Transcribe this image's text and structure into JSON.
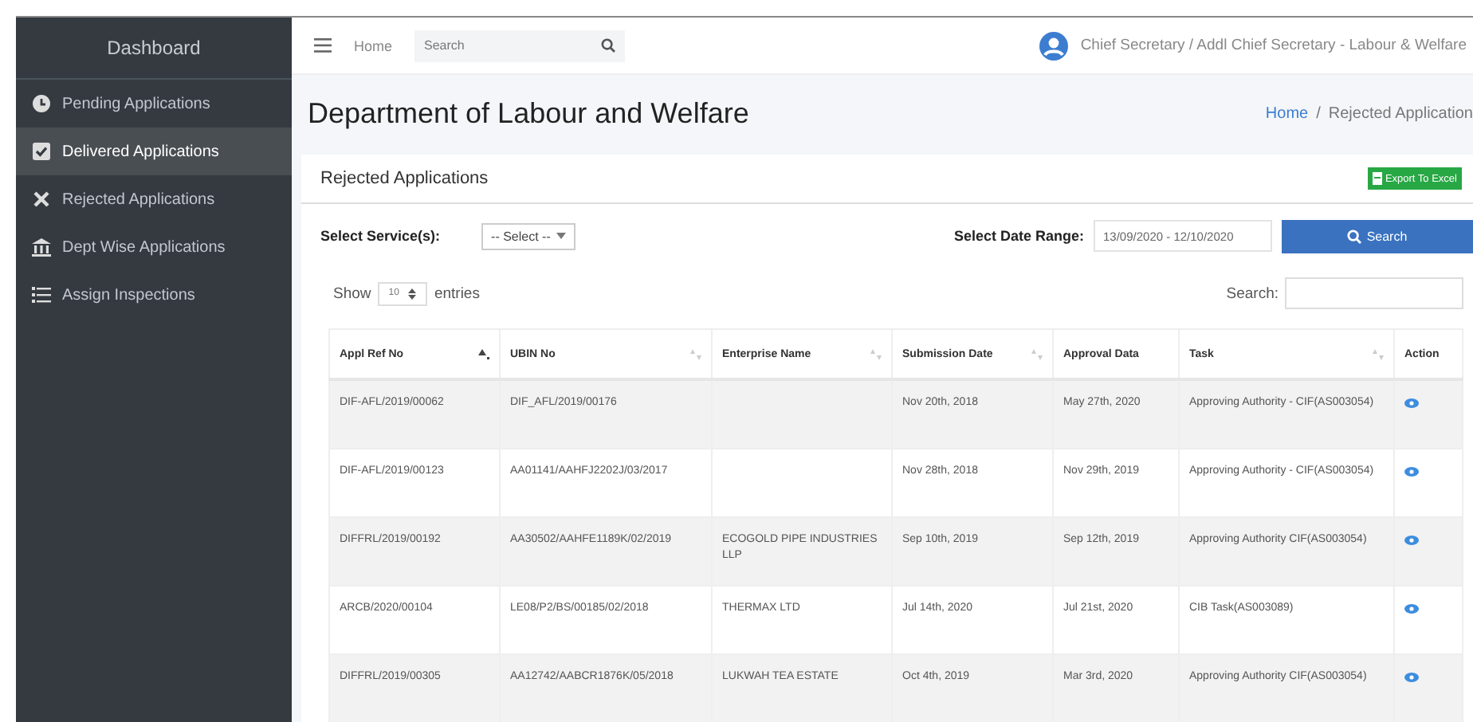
{
  "sidebar": {
    "title": "Dashboard",
    "items": [
      {
        "label": "Pending Applications",
        "selected": false
      },
      {
        "label": "Delivered Applications",
        "selected": true
      },
      {
        "label": "Rejected Applications",
        "selected": false
      },
      {
        "label": "Dept Wise Applications",
        "selected": false
      },
      {
        "label": "Assign Inspections",
        "selected": false
      }
    ]
  },
  "navbar": {
    "home": "Home",
    "search": {
      "placeholder": "Search"
    },
    "user": "Chief Secretary / Addl Chief Secretary - Labour & Welfare"
  },
  "header": {
    "title": "Department of Labour and Welfare",
    "breadcrumb": [
      "Home",
      "Rejected Application"
    ],
    "breadcrumb_separator": "/"
  },
  "card": {
    "title": "Rejected Applications",
    "export_button": "Export To Excel",
    "service_label": "Select Service(s):",
    "service_select": "-- Select --",
    "date_label": "Select Date Range:",
    "date_range": "13/09/2020 - 12/10/2020",
    "search_button": "Search",
    "show_label": "Show",
    "page_size": "10",
    "entries_label": "entries",
    "table_search_label": "Search:"
  },
  "table": {
    "columns": [
      {
        "label": "Appl Ref No",
        "kind": "sorted"
      },
      {
        "label": "UBIN No",
        "kind": "sortable"
      },
      {
        "label": "Enterprise Name",
        "kind": "sortable"
      },
      {
        "label": "Submission Date",
        "kind": "sortable"
      },
      {
        "label": "Approval Data",
        "kind": "plain"
      },
      {
        "label": "Task",
        "kind": "sortable"
      },
      {
        "label": "Action",
        "kind": "plain"
      }
    ],
    "rows": [
      [
        "DIF-AFL/2019/00062",
        "DIF_AFL/2019/00176",
        "",
        "Nov 20th, 2018",
        "May 27th, 2020",
        "Approving Authority - CIF(AS003054)"
      ],
      [
        "DIF-AFL/2019/00123",
        "AA01141/AAHFJ2202J/03/2017",
        "",
        "Nov 28th, 2018",
        "Nov 29th, 2019",
        "Approving Authority - CIF(AS003054)"
      ],
      [
        "DIFFRL/2019/00192",
        "AA30502/AAHFE1189K/02/2019",
        "ECOGOLD PIPE INDUSTRIES LLP",
        "Sep 10th, 2019",
        "Sep 12th, 2019",
        "Approving Authority CIF(AS003054)"
      ],
      [
        "ARCB/2020/00104",
        "LE08/P2/BS/00185/02/2018",
        "THERMAX LTD",
        "Jul 14th, 2020",
        "Jul 21st, 2020",
        "CIB Task(AS003089)"
      ],
      [
        "DIFFRL/2019/00305",
        "AA12742/AABCR1876K/05/2018",
        "LUKWAH TEA ESTATE",
        "Oct 4th, 2019",
        "Mar 3rd, 2020",
        "Approving Authority CIF(AS003054)"
      ]
    ]
  }
}
